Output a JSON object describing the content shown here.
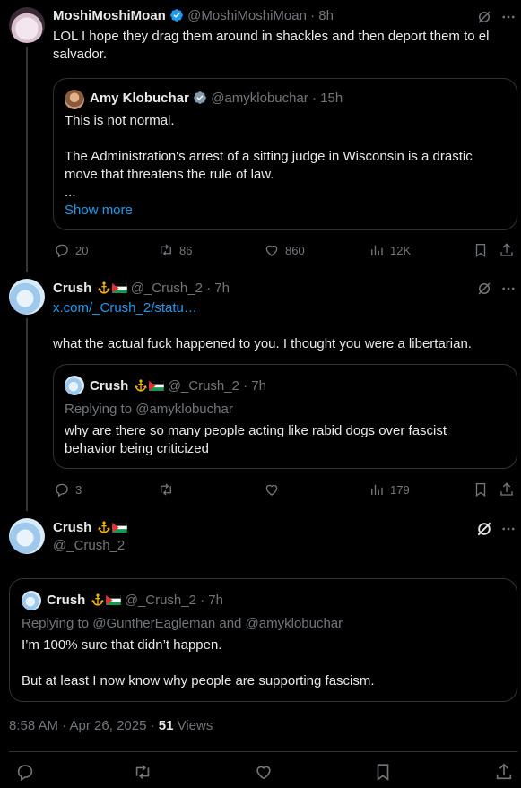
{
  "tweet1": {
    "name": "MoshiMoshiMoan",
    "handle": "@MoshiMoshiMoan",
    "time": "· 8h",
    "text": "LOL I hope they drag them around in shackles and then deport them to el salvador.",
    "quote": {
      "name": "Amy Klobuchar",
      "handle": "@amyklobuchar",
      "time": "· 15h",
      "line1": "This is not normal.",
      "line2": "The Administration's arrest of a sitting judge in Wisconsin is a drastic move that threatens the rule of law.",
      "ellipsis": "...",
      "show_more": "Show more"
    },
    "replies": "20",
    "reposts": "86",
    "likes": "860",
    "views": "12K"
  },
  "tweet2": {
    "name": "Crush",
    "handle": "@_Crush_2",
    "time": "· 7h",
    "link": "x.com/_Crush_2/statu…",
    "text": "what the actual fuck happened to you. I thought you were a libertarian.",
    "quote": {
      "name": "Crush",
      "handle": "@_Crush_2",
      "time": "· 7h",
      "replying": "Replying to @amyklobuchar",
      "text": "why are there so many people acting like rabid dogs over fascist behavior being criticized"
    },
    "replies": "3",
    "reposts": "",
    "likes": "",
    "views": "179"
  },
  "tweet3": {
    "name": "Crush",
    "handle": "@_Crush_2",
    "quote": {
      "name": "Crush",
      "handle": "@_Crush_2",
      "time": "· 7h",
      "replying": "Replying to @GuntherEagleman and @amyklobuchar",
      "line1": "I’m 100% sure that didn’t happen.",
      "line2": "But at least I now know why people are supporting fascism."
    },
    "meta_time": "8:58 AM · Apr 26, 2025 · ",
    "views_count": "51",
    "views_label": " Views"
  },
  "colors": {
    "accent": "#1d9bf0",
    "text": "#e7e9ea",
    "muted": "#71767b",
    "border": "#2f3336",
    "background": "#000000"
  }
}
